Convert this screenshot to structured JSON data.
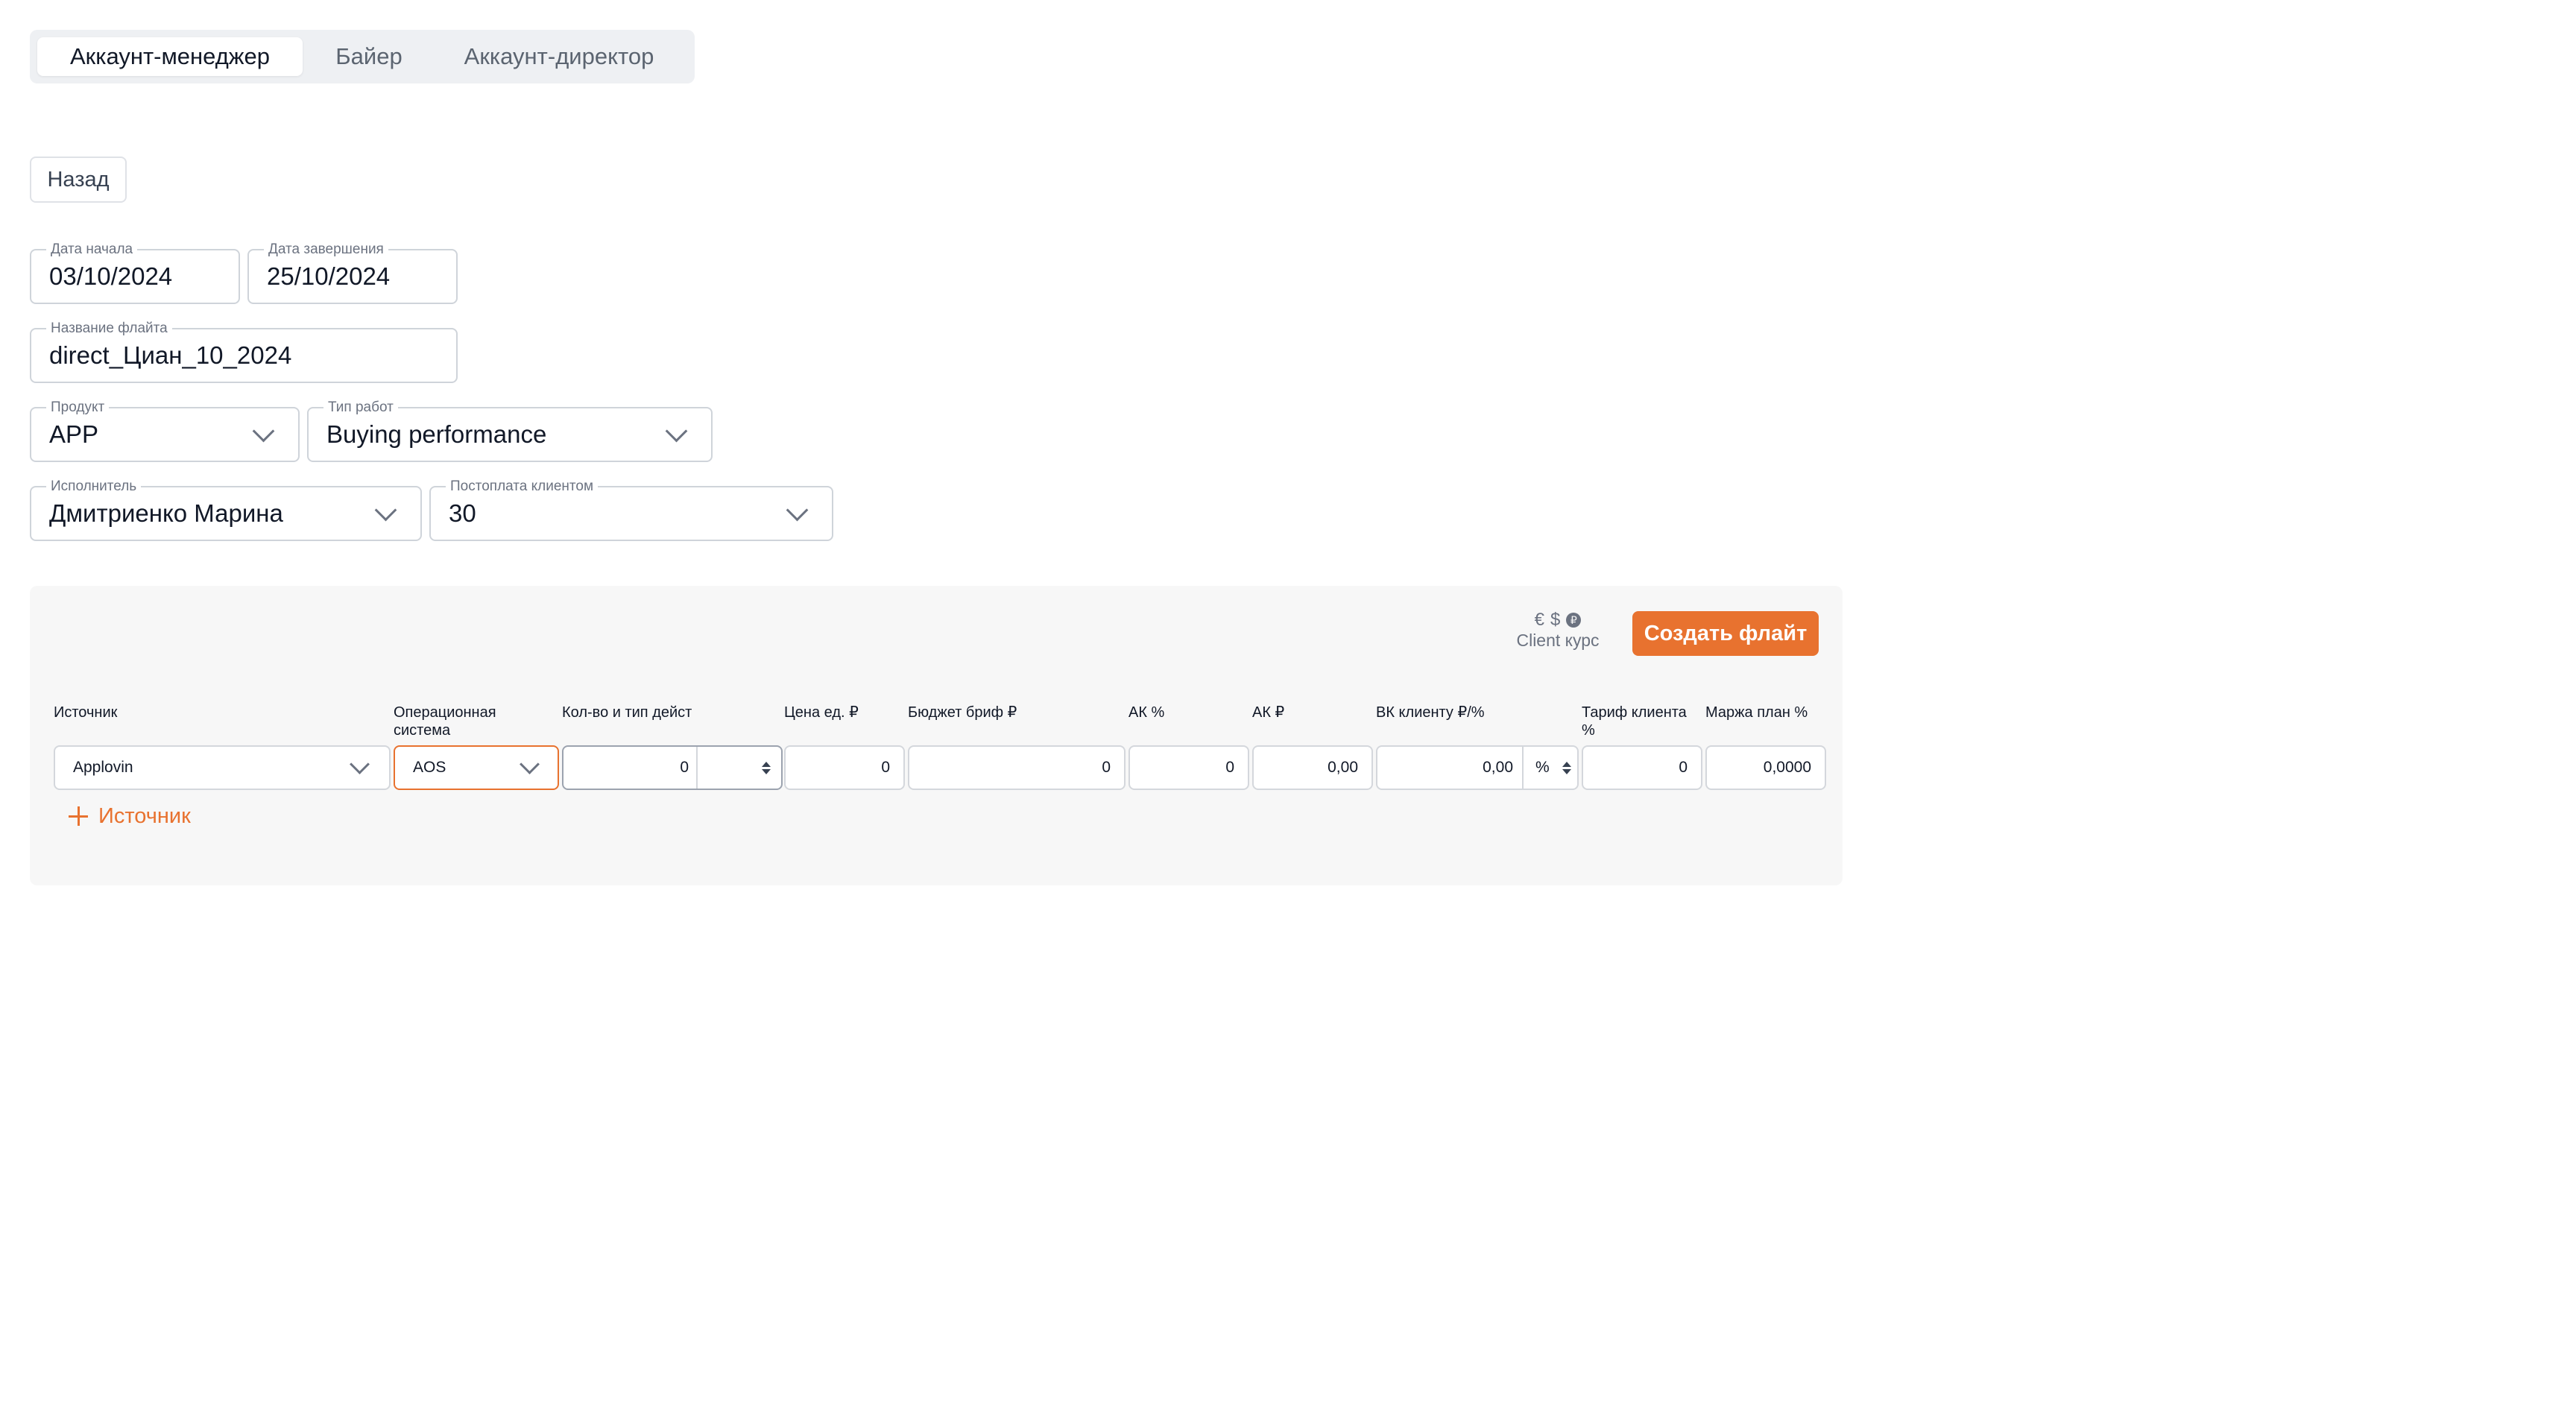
{
  "tabs": [
    "Аккаунт-менеджер",
    "Байер",
    "Аккаунт-директор"
  ],
  "back_label": "Назад",
  "form": {
    "start_date": {
      "label": "Дата начала",
      "value": "03/10/2024"
    },
    "end_date": {
      "label": "Дата завершения",
      "value": "25/10/2024"
    },
    "flight_name": {
      "label": "Название флайта",
      "value": "direct_Циан_10_2024"
    },
    "product": {
      "label": "Продукт",
      "value": "APP"
    },
    "work_type": {
      "label": "Тип работ",
      "value": "Buying performance"
    },
    "executor": {
      "label": "Исполнитель",
      "value": "Дмитриенко Марина"
    },
    "postpay": {
      "label": "Постоплата клиентом",
      "value": "30"
    }
  },
  "panel": {
    "currency_icons": [
      "€",
      "$",
      "₽"
    ],
    "currency_label": "Client курс",
    "create_label": "Создать флайт",
    "columns": [
      "Источник",
      "Операционная система",
      "Кол-во и тип дейст",
      "Цена ед. ₽",
      "Бюджет бриф ₽",
      "АК %",
      "АК ₽",
      "ВК клиенту ₽/%",
      "Тариф клиента %",
      "Маржа план %"
    ],
    "row": {
      "source": "Applovin",
      "os": "AOS",
      "qty": "0",
      "price": "0",
      "budget": "0",
      "ak_pct": "0",
      "ak_rub": "0,00",
      "vk": "0,00",
      "vk_unit": "%",
      "tariff": "0",
      "margin": "0,0000"
    },
    "add_source_label": "Источник"
  },
  "colors": {
    "accent": "#e8722f",
    "panel_bg": "#f7f7f7",
    "tabs_bg": "#eef0f3"
  }
}
